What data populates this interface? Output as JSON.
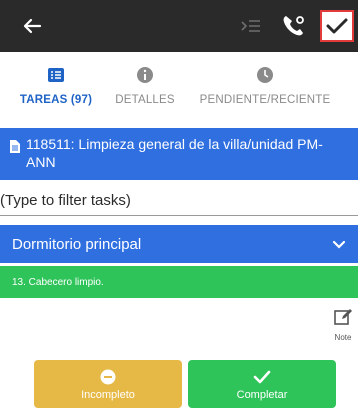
{
  "topbar": {
    "icons": [
      "back-arrow-icon",
      "collapse-list-icon",
      "phone-settings-icon",
      "check-icon"
    ],
    "colors": {
      "background": "#2a2a2a",
      "highlight": "#e23b3b"
    }
  },
  "tabs": [
    {
      "label": "TAREAS (97)",
      "icon": "list-icon",
      "active": true
    },
    {
      "label": "DETALLES",
      "icon": "info-icon",
      "active": false
    },
    {
      "label": "PENDIENTE/RECIENTE",
      "icon": "clock-icon",
      "active": false
    }
  ],
  "work_order": {
    "title": "118511: Limpieza general de la villa/unidad PM-ANN",
    "icon": "document-icon"
  },
  "filter": {
    "placeholder": "(Type to filter tasks)",
    "value": ""
  },
  "section": {
    "title": "Dormitorio principal",
    "icon": "chevron-down-icon"
  },
  "task": {
    "label": "13. Cabecero limpio."
  },
  "note": {
    "label": "Note",
    "icon": "edit-icon"
  },
  "actions": {
    "incomplete": {
      "label": "Incompleto",
      "icon": "minus-circle-icon"
    },
    "complete": {
      "label": "Completar",
      "icon": "check-icon"
    }
  },
  "colors": {
    "accent": "#2f6fe0",
    "success": "#2fc45a",
    "warning": "#e6b845"
  }
}
